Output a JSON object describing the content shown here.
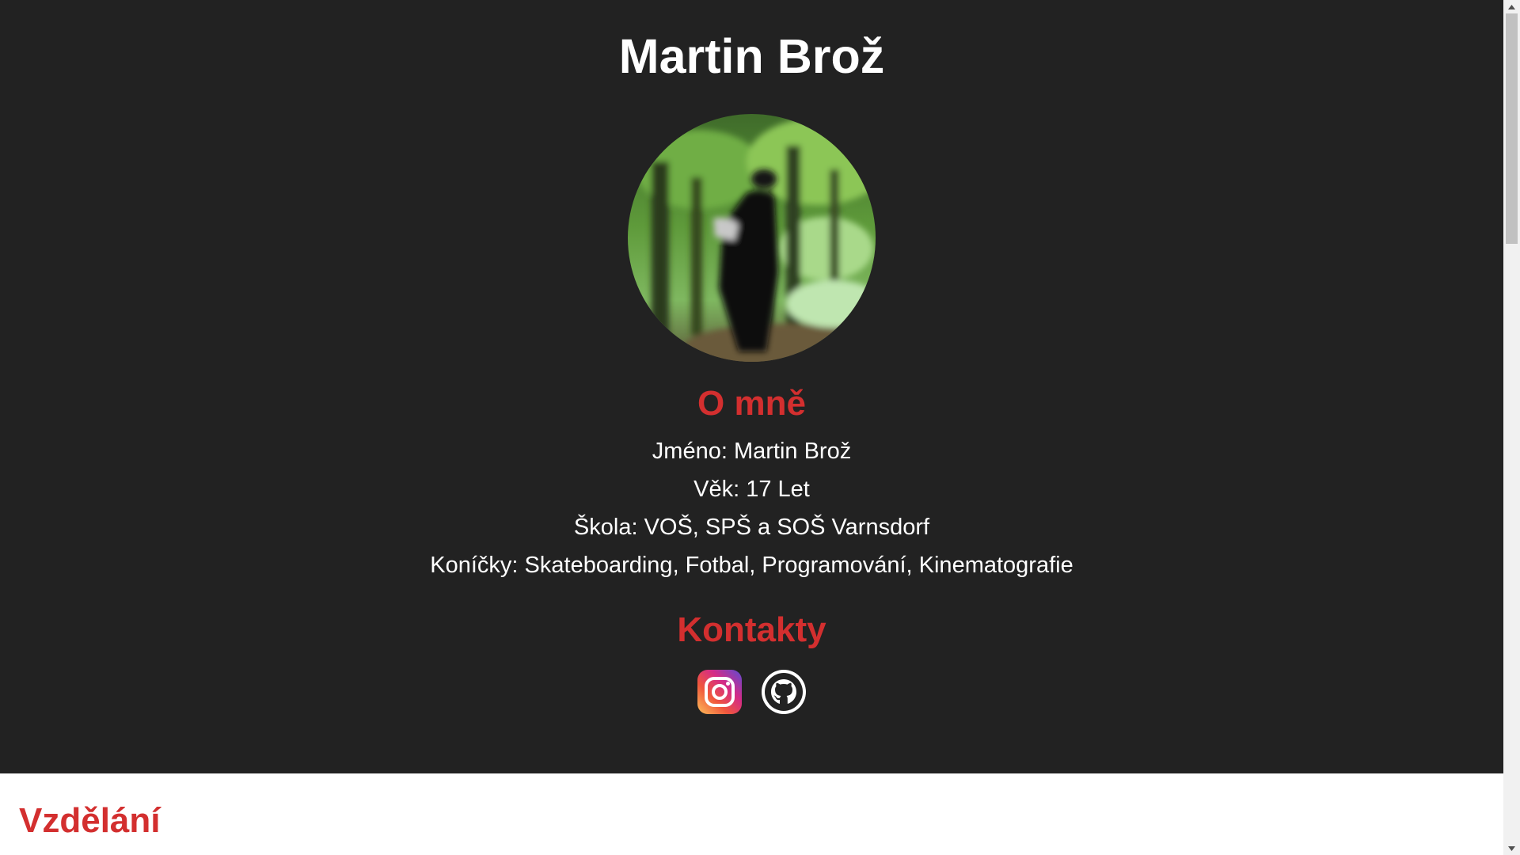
{
  "header": {
    "title": "Martin Brož"
  },
  "about": {
    "heading": "O mně",
    "lines": [
      "Jméno: Martin Brož",
      "Věk: 17 Let",
      "Škola: VOŠ, SPŠ a SOŠ Varnsdorf",
      "Koníčky: Skateboarding, Fotbal, Programování, Kinematografie"
    ]
  },
  "contacts": {
    "heading": "Kontakty",
    "icons": [
      "instagram-icon",
      "github-icon"
    ]
  },
  "education": {
    "heading": "Vzdělání"
  },
  "colors": {
    "hero_background": "#222222",
    "accent": "#d32f2f",
    "text": "#ffffff",
    "page_background": "#ffffff"
  }
}
